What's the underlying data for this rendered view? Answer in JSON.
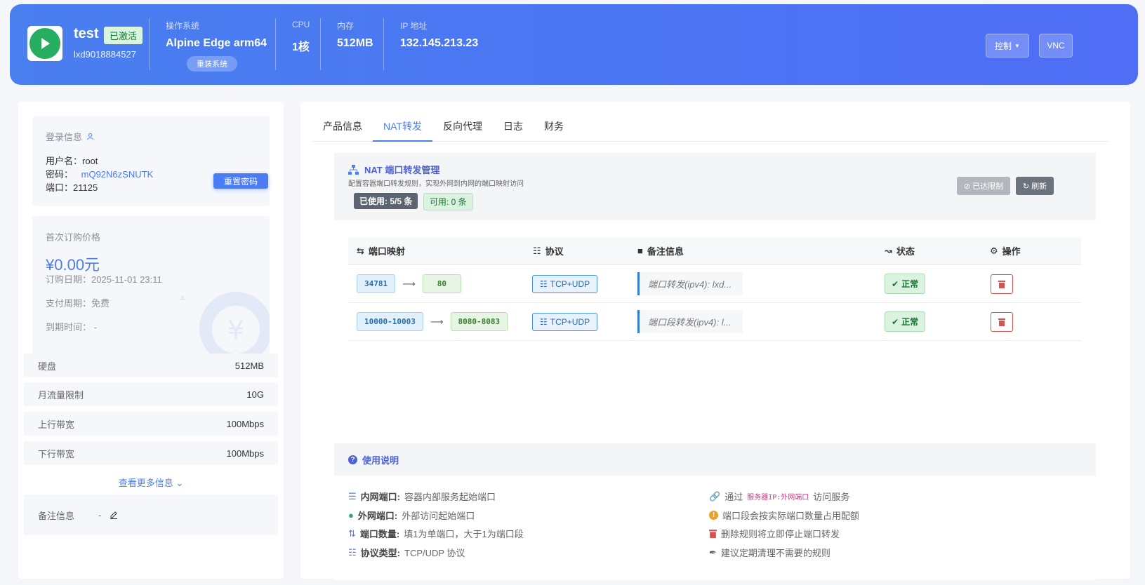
{
  "header": {
    "name": "test",
    "status": "已激活",
    "id": "lxd9018884527",
    "os_label": "操作系统",
    "os_value": "Alpine Edge arm64",
    "reinstall": "重装系统",
    "cpu_label": "CPU",
    "cpu_value": "1核",
    "mem_label": "内存",
    "mem_value": "512MB",
    "ip_label": "IP 地址",
    "ip_value": "132.145.213.23",
    "control_btn": "控制",
    "vnc_btn": "VNC"
  },
  "login": {
    "title": "登录信息",
    "user_label": "用户名：",
    "user": "root",
    "pass_label": "密码：",
    "pass": "mQ92N6zSNUTK",
    "port_label": "端口：",
    "port": "21125",
    "reset_btn": "重置密码"
  },
  "price": {
    "title": "首次订购价格",
    "amount": "¥0.00元",
    "order_date": "订购日期：2025-11-01 23:11",
    "cycle": "支付周期：免费",
    "expire": "到期时间：  -"
  },
  "specs": [
    {
      "label": "硬盘",
      "value": "512MB"
    },
    {
      "label": "月流量限制",
      "value": "10G"
    },
    {
      "label": "上行带宽",
      "value": "100Mbps"
    },
    {
      "label": "下行带宽",
      "value": "100Mbps"
    }
  ],
  "more_link": "查看更多信息",
  "remark": {
    "label": "备注信息",
    "value": "-"
  },
  "tabs": [
    "产品信息",
    "NAT转发",
    "反向代理",
    "日志",
    "财务"
  ],
  "nat": {
    "title": "NAT 端口转发管理",
    "subtitle": "配置容器端口转发规则，实现外网到内网的端口映射访问",
    "used": "已使用: 5/5 条",
    "available": "可用: 0 条",
    "limit_btn": "已达限制",
    "refresh_btn": "刷新",
    "columns": [
      "端口映射",
      "协议",
      "备注信息",
      "状态",
      "操作"
    ],
    "rows": [
      {
        "src": "34781",
        "dst": "80",
        "proto": "TCP+UDP",
        "note": "端口转发(ipv4): lxd...",
        "status": "正常"
      },
      {
        "src": "10000-10003",
        "dst": "8080-8083",
        "proto": "TCP+UDP",
        "note": "端口段转发(ipv4): l...",
        "status": "正常"
      }
    ]
  },
  "help": {
    "title": "使用说明",
    "items_left": [
      {
        "key": "内网端口:",
        "text": "容器内部服务起始端口"
      },
      {
        "key": "外网端口:",
        "text": "外部访问起始端口"
      },
      {
        "key": "端口数量:",
        "text": "填1为单端口，大于1为端口段"
      },
      {
        "key": "协议类型:",
        "text": "TCP/UDP 协议"
      }
    ],
    "via_pre": "通过",
    "via_code": "服务器IP:外网端口",
    "via_post": "访问服务",
    "items_right": [
      "端口段会按实际端口数量占用配额",
      "删除规则将立即停止端口转发",
      "建议定期清理不需要的规则"
    ]
  }
}
